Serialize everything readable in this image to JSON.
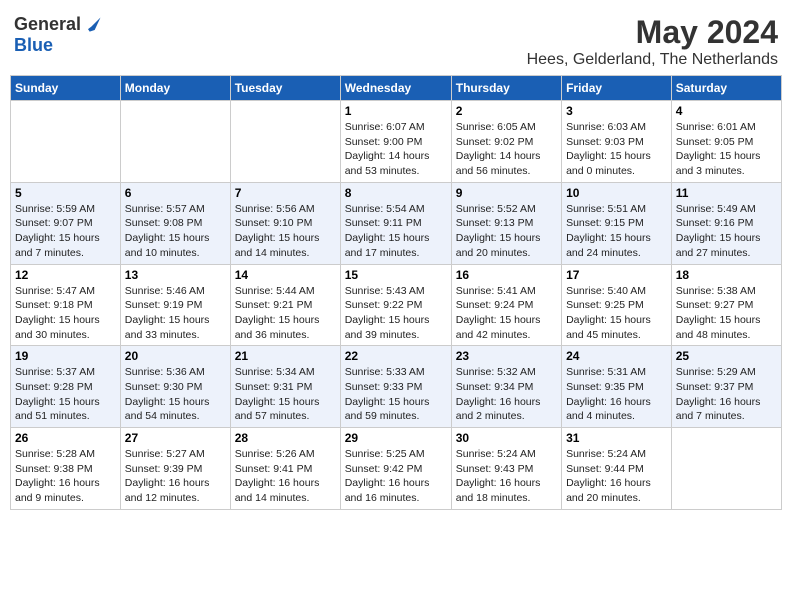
{
  "header": {
    "logo": {
      "general": "General",
      "blue": "Blue"
    },
    "title": "May 2024",
    "subtitle": "Hees, Gelderland, The Netherlands"
  },
  "weekdays": [
    "Sunday",
    "Monday",
    "Tuesday",
    "Wednesday",
    "Thursday",
    "Friday",
    "Saturday"
  ],
  "weeks": [
    [
      {
        "day": "",
        "info": ""
      },
      {
        "day": "",
        "info": ""
      },
      {
        "day": "",
        "info": ""
      },
      {
        "day": "1",
        "info": "Sunrise: 6:07 AM\nSunset: 9:00 PM\nDaylight: 14 hours and 53 minutes."
      },
      {
        "day": "2",
        "info": "Sunrise: 6:05 AM\nSunset: 9:02 PM\nDaylight: 14 hours and 56 minutes."
      },
      {
        "day": "3",
        "info": "Sunrise: 6:03 AM\nSunset: 9:03 PM\nDaylight: 15 hours and 0 minutes."
      },
      {
        "day": "4",
        "info": "Sunrise: 6:01 AM\nSunset: 9:05 PM\nDaylight: 15 hours and 3 minutes."
      }
    ],
    [
      {
        "day": "5",
        "info": "Sunrise: 5:59 AM\nSunset: 9:07 PM\nDaylight: 15 hours and 7 minutes."
      },
      {
        "day": "6",
        "info": "Sunrise: 5:57 AM\nSunset: 9:08 PM\nDaylight: 15 hours and 10 minutes."
      },
      {
        "day": "7",
        "info": "Sunrise: 5:56 AM\nSunset: 9:10 PM\nDaylight: 15 hours and 14 minutes."
      },
      {
        "day": "8",
        "info": "Sunrise: 5:54 AM\nSunset: 9:11 PM\nDaylight: 15 hours and 17 minutes."
      },
      {
        "day": "9",
        "info": "Sunrise: 5:52 AM\nSunset: 9:13 PM\nDaylight: 15 hours and 20 minutes."
      },
      {
        "day": "10",
        "info": "Sunrise: 5:51 AM\nSunset: 9:15 PM\nDaylight: 15 hours and 24 minutes."
      },
      {
        "day": "11",
        "info": "Sunrise: 5:49 AM\nSunset: 9:16 PM\nDaylight: 15 hours and 27 minutes."
      }
    ],
    [
      {
        "day": "12",
        "info": "Sunrise: 5:47 AM\nSunset: 9:18 PM\nDaylight: 15 hours and 30 minutes."
      },
      {
        "day": "13",
        "info": "Sunrise: 5:46 AM\nSunset: 9:19 PM\nDaylight: 15 hours and 33 minutes."
      },
      {
        "day": "14",
        "info": "Sunrise: 5:44 AM\nSunset: 9:21 PM\nDaylight: 15 hours and 36 minutes."
      },
      {
        "day": "15",
        "info": "Sunrise: 5:43 AM\nSunset: 9:22 PM\nDaylight: 15 hours and 39 minutes."
      },
      {
        "day": "16",
        "info": "Sunrise: 5:41 AM\nSunset: 9:24 PM\nDaylight: 15 hours and 42 minutes."
      },
      {
        "day": "17",
        "info": "Sunrise: 5:40 AM\nSunset: 9:25 PM\nDaylight: 15 hours and 45 minutes."
      },
      {
        "day": "18",
        "info": "Sunrise: 5:38 AM\nSunset: 9:27 PM\nDaylight: 15 hours and 48 minutes."
      }
    ],
    [
      {
        "day": "19",
        "info": "Sunrise: 5:37 AM\nSunset: 9:28 PM\nDaylight: 15 hours and 51 minutes."
      },
      {
        "day": "20",
        "info": "Sunrise: 5:36 AM\nSunset: 9:30 PM\nDaylight: 15 hours and 54 minutes."
      },
      {
        "day": "21",
        "info": "Sunrise: 5:34 AM\nSunset: 9:31 PM\nDaylight: 15 hours and 57 minutes."
      },
      {
        "day": "22",
        "info": "Sunrise: 5:33 AM\nSunset: 9:33 PM\nDaylight: 15 hours and 59 minutes."
      },
      {
        "day": "23",
        "info": "Sunrise: 5:32 AM\nSunset: 9:34 PM\nDaylight: 16 hours and 2 minutes."
      },
      {
        "day": "24",
        "info": "Sunrise: 5:31 AM\nSunset: 9:35 PM\nDaylight: 16 hours and 4 minutes."
      },
      {
        "day": "25",
        "info": "Sunrise: 5:29 AM\nSunset: 9:37 PM\nDaylight: 16 hours and 7 minutes."
      }
    ],
    [
      {
        "day": "26",
        "info": "Sunrise: 5:28 AM\nSunset: 9:38 PM\nDaylight: 16 hours and 9 minutes."
      },
      {
        "day": "27",
        "info": "Sunrise: 5:27 AM\nSunset: 9:39 PM\nDaylight: 16 hours and 12 minutes."
      },
      {
        "day": "28",
        "info": "Sunrise: 5:26 AM\nSunset: 9:41 PM\nDaylight: 16 hours and 14 minutes."
      },
      {
        "day": "29",
        "info": "Sunrise: 5:25 AM\nSunset: 9:42 PM\nDaylight: 16 hours and 16 minutes."
      },
      {
        "day": "30",
        "info": "Sunrise: 5:24 AM\nSunset: 9:43 PM\nDaylight: 16 hours and 18 minutes."
      },
      {
        "day": "31",
        "info": "Sunrise: 5:24 AM\nSunset: 9:44 PM\nDaylight: 16 hours and 20 minutes."
      },
      {
        "day": "",
        "info": ""
      }
    ]
  ]
}
